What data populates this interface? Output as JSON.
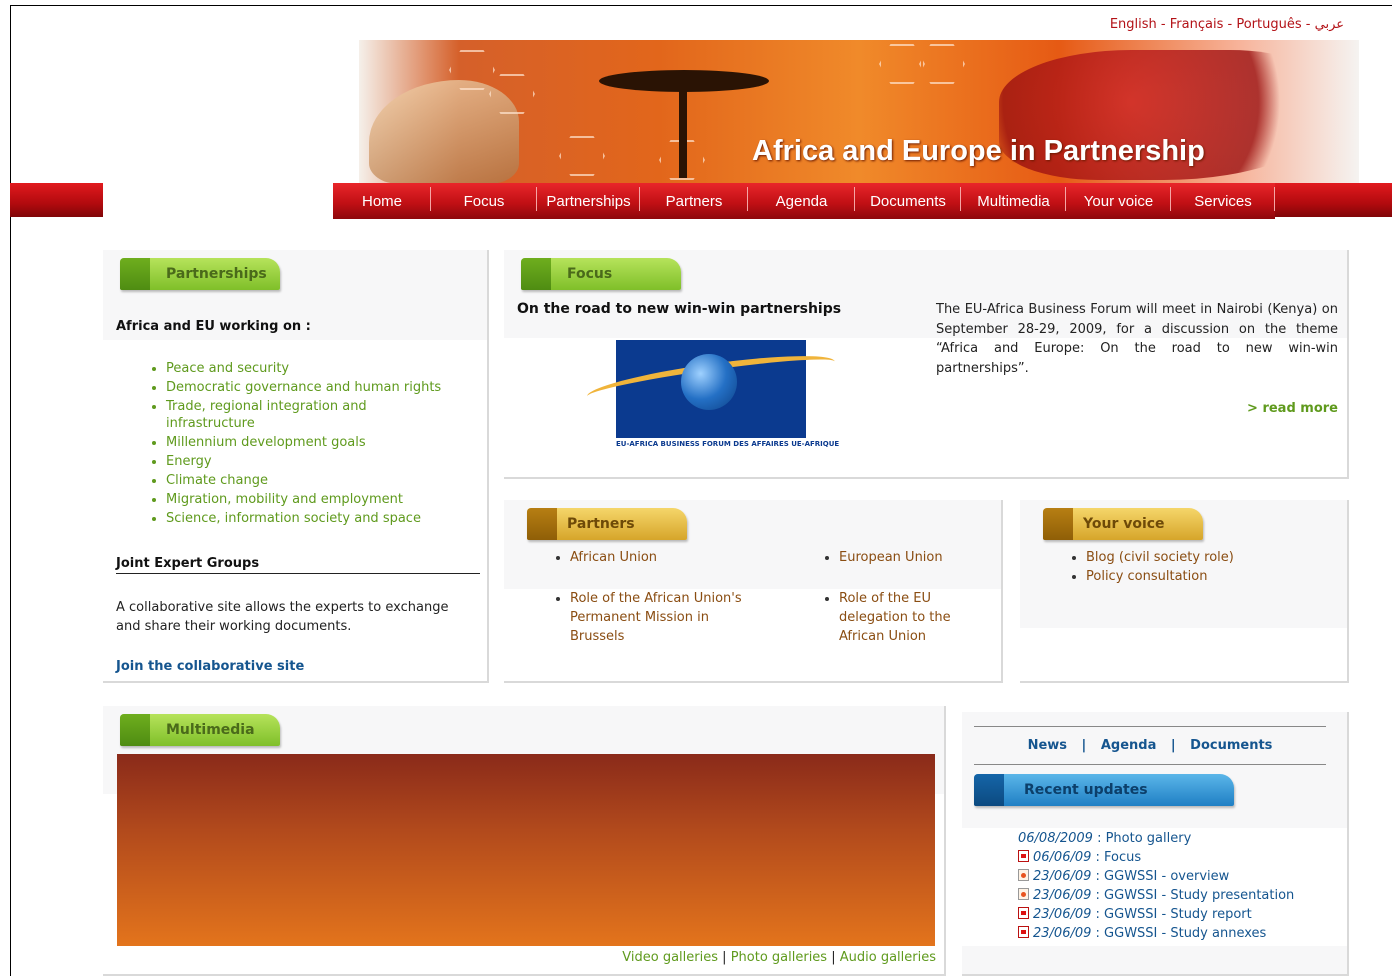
{
  "languages": [
    "English",
    "Français",
    "Português",
    "عربي"
  ],
  "language_separator": "-",
  "banner_title": "Africa and Europe in Partnership",
  "nav": [
    "Home",
    "Focus",
    "Partnerships",
    "Partners",
    "Agenda",
    "Documents",
    "Multimedia",
    "Your voice",
    "Services"
  ],
  "partnerships": {
    "tab": "Partnerships",
    "heading": "Africa and EU working on :",
    "items": [
      "Peace and security",
      "Democratic governance and human rights",
      "Trade, regional integration and infrastructure",
      "Millennium development goals",
      "Energy",
      "Climate change",
      "Migration, mobility and employment",
      "Science, information society and space"
    ],
    "jeg_heading": "Joint Expert Groups",
    "jeg_text": "A collaborative site allows the experts to exchange and share their working documents.",
    "jeg_link": "Join the collaborative site"
  },
  "focus": {
    "tab": "Focus",
    "headline": "On the road to new win-win partnerships",
    "logo_caption": "EU-AFRICA BUSINESS FORUM DES AFFAIRES UE-AFRIQUE",
    "text": "The EU-Africa Business Forum will meet in Nairobi (Kenya) on September 28-29, 2009, for a discussion on the theme “Africa and Europe: On the road to new win-win partnerships”.",
    "read_more": "> read more"
  },
  "partners": {
    "tab": "Partners",
    "col1": [
      "African Union",
      "Role of the African Union's Permanent Mission in Brussels"
    ],
    "col2": [
      "European Union",
      "Role of the EU delegation to the African Union"
    ]
  },
  "your_voice": {
    "tab": "Your voice",
    "items": [
      "Blog (civil society role)",
      "Policy consultation"
    ]
  },
  "multimedia": {
    "tab": "Multimedia",
    "links": [
      "Video galleries",
      "Photo galleries",
      "Audio galleries"
    ],
    "link_separator": "|"
  },
  "updates": {
    "subnav": [
      "News",
      "Agenda",
      "Documents"
    ],
    "subnav_separator": "|",
    "tab": "Recent updates",
    "items": [
      {
        "icon": "none",
        "date": "06/08/2009",
        "sep": " : ",
        "title": "Photo gallery"
      },
      {
        "icon": "pdf",
        "date": "06/06/09",
        "sep": " : ",
        "title": "Focus"
      },
      {
        "icon": "ppt",
        "date": "23/06/09",
        "sep": " : ",
        "title": "GGWSSI - overview"
      },
      {
        "icon": "ppt",
        "date": "23/06/09",
        "sep": " : ",
        "title": "GGWSSI - Study presentation"
      },
      {
        "icon": "pdf",
        "date": "23/06/09",
        "sep": " : ",
        "title": "GGWSSI - Study report"
      },
      {
        "icon": "pdf",
        "date": "23/06/09",
        "sep": " : ",
        "title": "GGWSSI - Study annexes"
      }
    ]
  },
  "colors": {
    "nav_red": "#c21015",
    "link_green": "#5f9a1d",
    "link_blue": "#15558f",
    "lang_red": "#b31217"
  }
}
